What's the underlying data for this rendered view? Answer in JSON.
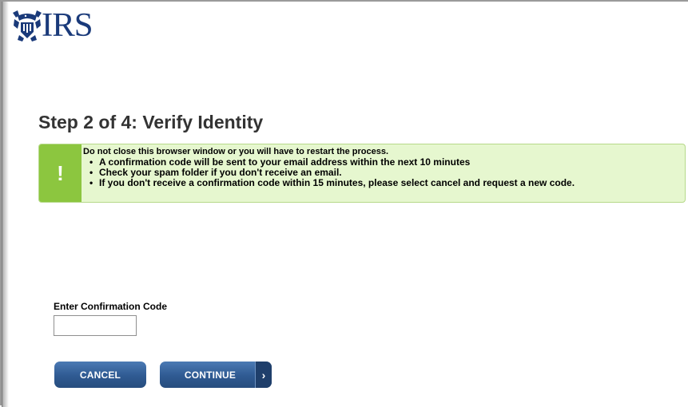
{
  "header": {
    "logo_text": "IRS"
  },
  "page": {
    "title": "Step 2 of 4:  Verify Identity"
  },
  "alert": {
    "icon": "exclamation-icon",
    "title": "Do not close this browser window or you will have to restart the process.",
    "items": [
      "A confirmation code will be sent to your email address within the next 10 minutes",
      "Check your spam folder if you don't receive an email.",
      "If you don't receive a confirmation code within 15 minutes, please select cancel and request a new code."
    ],
    "colors": {
      "background": "#e6f7cf",
      "icon_background": "#8cc63f"
    }
  },
  "form": {
    "confirmation_label": "Enter Confirmation Code",
    "confirmation_value": "",
    "confirmation_placeholder": ""
  },
  "actions": {
    "cancel_label": "CANCEL",
    "continue_label": "CONTINUE",
    "continue_icon": "chevron-right-icon",
    "button_color": "#2f5a92"
  }
}
